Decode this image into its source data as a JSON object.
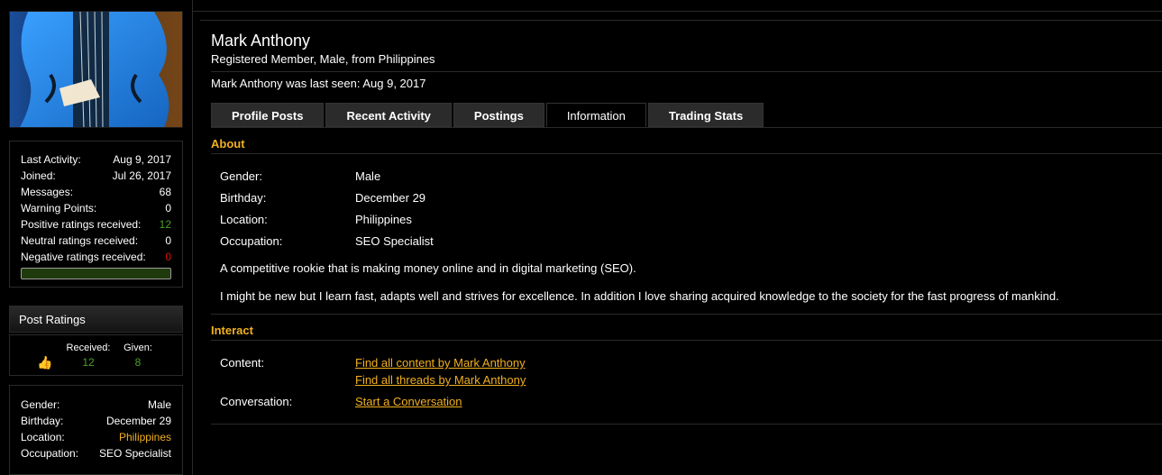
{
  "sidebar": {
    "stats": [
      {
        "label": "Last Activity:",
        "value": "Aug 9, 2017",
        "color": ""
      },
      {
        "label": "Joined:",
        "value": "Jul 26, 2017",
        "color": ""
      },
      {
        "label": "Messages:",
        "value": "68",
        "color": ""
      },
      {
        "label": "Warning Points:",
        "value": "0",
        "color": ""
      },
      {
        "label": "Positive ratings received:",
        "value": "12",
        "color": "green"
      },
      {
        "label": "Neutral ratings received:",
        "value": "0",
        "color": ""
      },
      {
        "label": "Negative ratings received:",
        "value": "0",
        "color": "red"
      }
    ],
    "rating_fraction": 1.0,
    "post_ratings": {
      "title": "Post Ratings",
      "received_label": "Received:",
      "received_value": "12",
      "given_label": "Given:",
      "given_value": "8",
      "icon": "thumbs-up-icon"
    },
    "info": [
      {
        "label": "Gender:",
        "value": "Male",
        "color": ""
      },
      {
        "label": "Birthday:",
        "value": "December 29",
        "color": ""
      },
      {
        "label": "Location:",
        "value": "Philippines",
        "color": "orange"
      },
      {
        "label": "Occupation:",
        "value": "SEO Specialist",
        "color": ""
      }
    ]
  },
  "profile": {
    "name": "Mark Anthony",
    "subtitle": "Registered Member, Male, from Philippines",
    "last_seen": "Mark Anthony was last seen: Aug 9, 2017"
  },
  "tabs": [
    {
      "label": "Profile Posts",
      "active": false
    },
    {
      "label": "Recent Activity",
      "active": false
    },
    {
      "label": "Postings",
      "active": false
    },
    {
      "label": "Information",
      "active": true
    },
    {
      "label": "Trading Stats",
      "active": false
    }
  ],
  "about": {
    "heading": "About",
    "fields": [
      {
        "label": "Gender:",
        "value": "Male"
      },
      {
        "label": "Birthday:",
        "value": "December 29"
      },
      {
        "label": "Location:",
        "value": "Philippines"
      },
      {
        "label": "Occupation:",
        "value": "SEO Specialist"
      }
    ],
    "paragraphs": [
      "A competitive rookie that is making money online and in digital marketing (SEO).",
      "I might be new but I learn fast, adapts well and strives for excellence. In addition I love sharing acquired knowledge to the society for the fast progress of mankind."
    ]
  },
  "interact": {
    "heading": "Interact",
    "content_label": "Content:",
    "content_links": [
      "Find all content by Mark Anthony",
      "Find all threads by Mark Anthony"
    ],
    "conversation_label": "Conversation:",
    "conversation_link": "Start a Conversation"
  },
  "colors": {
    "accent": "#f2b01e",
    "positive": "#4aa12a",
    "negative": "#dd1111",
    "background": "#000000"
  }
}
